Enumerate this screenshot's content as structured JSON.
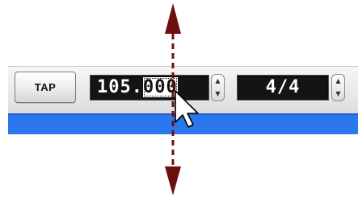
{
  "toolbar": {
    "tap_label": "TAP",
    "tempo": {
      "value_prefix": "105.",
      "value_selected": "000"
    },
    "meter": {
      "value": "4/4"
    }
  },
  "icons": {
    "stepper_up": "▲",
    "stepper_down": "▼",
    "cursor": "arrow-pointer-icon",
    "drag_indicator": "vertical-double-arrow-icon"
  },
  "colors": {
    "accent_blue": "#2b77f0",
    "arrow_red": "#6e0f0f",
    "field_background": "#141414"
  }
}
